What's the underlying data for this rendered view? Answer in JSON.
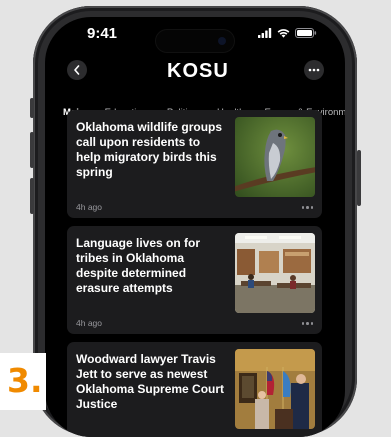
{
  "status_bar": {
    "time": "9:41"
  },
  "header": {
    "logo": "KOSU"
  },
  "tabs": [
    "Main",
    "Education",
    "Politics",
    "Health",
    "Energy & Environment"
  ],
  "active_tab_index": 0,
  "articles": [
    {
      "title": "Oklahoma wildlife groups call upon residents to help migratory birds this spring",
      "time": "4h ago",
      "image_icon": "hawk-photo"
    },
    {
      "title": "Language lives on for tribes in Oklahoma despite determined erasure attempts",
      "time": "4h ago",
      "image_icon": "classroom-photo"
    },
    {
      "title": "Woodward lawyer Travis Jett to serve as newest Oklahoma Supreme Court Justice",
      "time": "",
      "image_icon": "flags-podium-photo"
    }
  ],
  "overlay_label": "3.",
  "colors": {
    "screen_bg": "#000000",
    "card_bg": "#1c1c1e",
    "badge": "#f08a00"
  }
}
